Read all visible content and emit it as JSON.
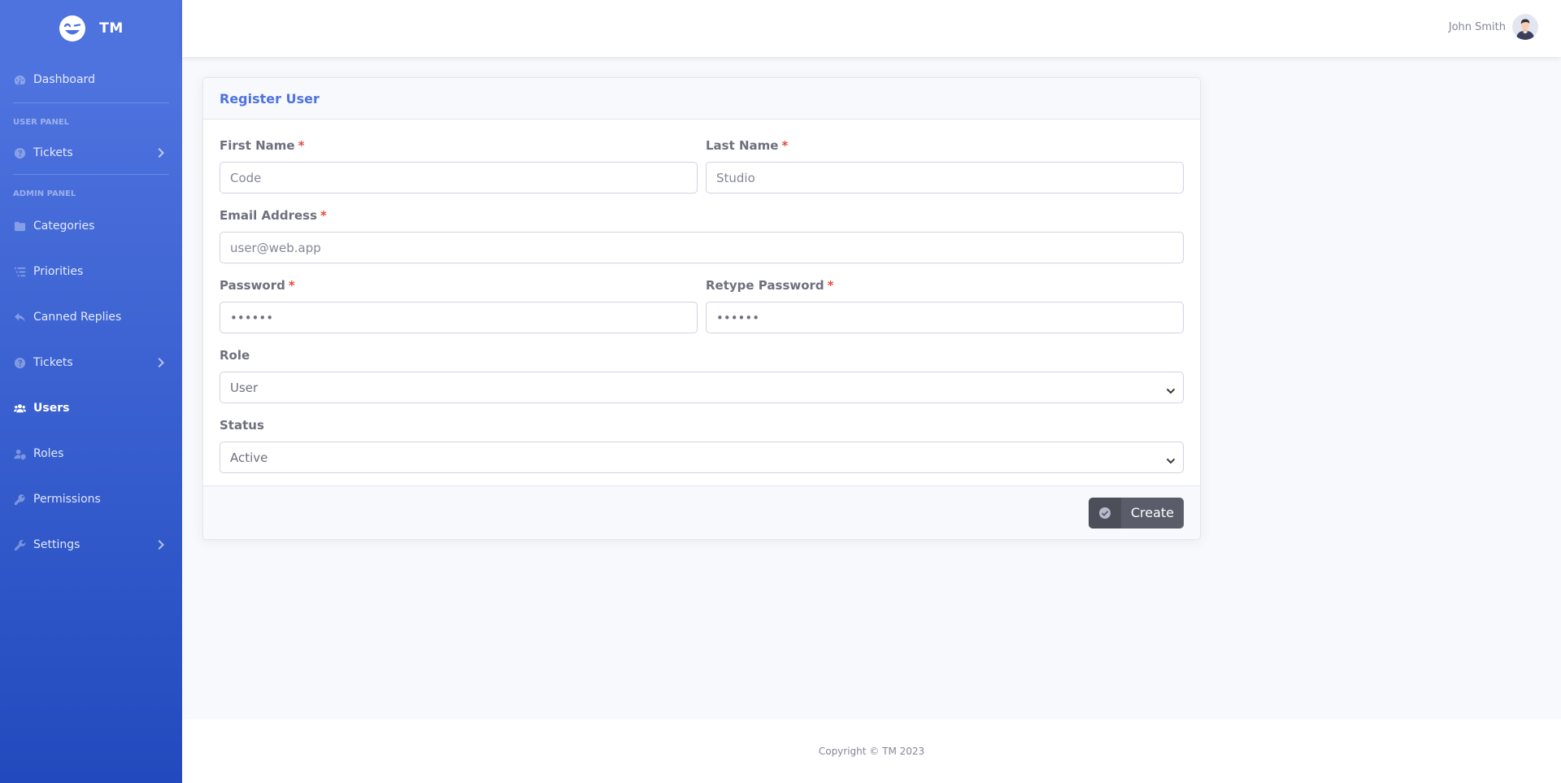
{
  "brand": {
    "name": "TM",
    "logo_icon": "wink-smile-icon"
  },
  "sidebar": {
    "dashboard": {
      "label": "Dashboard",
      "icon": "tachometer-icon"
    },
    "user_panel_heading": "USER PANEL",
    "user_tickets": {
      "label": "Tickets",
      "icon": "question-circle-icon"
    },
    "admin_panel_heading": "ADMIN PANEL",
    "items": [
      {
        "label": "Categories",
        "icon": "folder-icon"
      },
      {
        "label": "Priorities",
        "icon": "list-icon"
      },
      {
        "label": "Canned Replies",
        "icon": "reply-icon"
      },
      {
        "label": "Tickets",
        "icon": "question-circle-icon"
      },
      {
        "label": "Users",
        "icon": "users-icon",
        "active": true
      },
      {
        "label": "Roles",
        "icon": "user-shield-icon"
      },
      {
        "label": "Permissions",
        "icon": "key-icon"
      },
      {
        "label": "Settings",
        "icon": "wrench-icon"
      }
    ]
  },
  "topbar": {
    "user_name": "John Smith",
    "avatar_icon": "user-avatar"
  },
  "form": {
    "title": "Register User",
    "first_name": {
      "label": "First Name",
      "required_mark": "*",
      "placeholder": "Code",
      "value": ""
    },
    "last_name": {
      "label": "Last Name",
      "required_mark": "*",
      "placeholder": "Studio",
      "value": ""
    },
    "email": {
      "label": "Email Address",
      "required_mark": "*",
      "placeholder": "user@web.app",
      "value": ""
    },
    "password": {
      "label": "Password",
      "required_mark": "*",
      "value": "••••••"
    },
    "retype_password": {
      "label": "Retype Password",
      "required_mark": "*",
      "value": "••••••"
    },
    "role": {
      "label": "Role",
      "selected": "User"
    },
    "status": {
      "label": "Status",
      "selected": "Active"
    },
    "submit": {
      "label": "Create",
      "icon": "check-circle-icon"
    }
  },
  "footer": {
    "copyright": "Copyright © TM 2023"
  },
  "colors": {
    "sidebar_top": "#4e73df",
    "sidebar_bottom": "#224abe",
    "primary": "#4e73df",
    "required": "#e74a3b",
    "button_dark": "#5a5c69",
    "page_bg": "#f8f9fc"
  }
}
